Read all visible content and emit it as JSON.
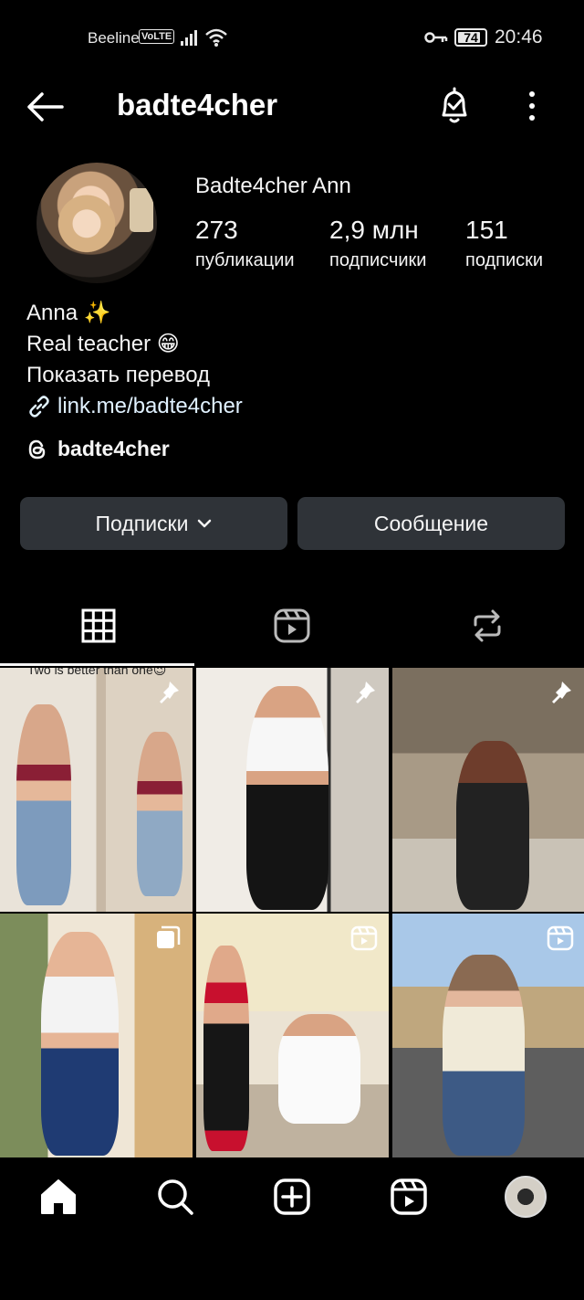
{
  "status_bar": {
    "carrier": "Beeline",
    "volte": "VoLTE",
    "battery": "74",
    "battery_level": 0.74,
    "time": "20:46"
  },
  "header": {
    "username": "badte4cher",
    "icons": [
      "back-arrow-icon",
      "notification-bell-icon",
      "more-icon"
    ]
  },
  "profile": {
    "full_name": "Badte4cher Ann",
    "stats": [
      {
        "value": "273",
        "label": "публикации"
      },
      {
        "value": "2,9 млн",
        "label": "подписчики"
      },
      {
        "value": "151",
        "label": "подписки"
      }
    ],
    "bio": {
      "line1": "Anna ✨",
      "line2": "Real teacher 😁",
      "translate": "Показать перевод",
      "link": "link.me/badte4cher"
    },
    "threads_handle": "badte4cher"
  },
  "actions": {
    "following_label": "Подписки",
    "message_label": "Сообщение"
  },
  "tabs": [
    "grid-icon",
    "reels-icon",
    "reposts-icon"
  ],
  "posts": [
    {
      "badge": "pin-icon",
      "caption": "Two is better than one😉"
    },
    {
      "badge": "pin-icon"
    },
    {
      "badge": "pin-icon"
    },
    {
      "badge": "carousel-icon"
    },
    {
      "badge": "reel-icon"
    },
    {
      "badge": "reel-icon"
    }
  ],
  "bottom_nav": [
    "home-icon",
    "search-icon",
    "create-icon",
    "reels-icon",
    "profile-avatar"
  ],
  "colors": {
    "background": "#000000",
    "button_bg": "#2f3338",
    "text": "#f5f5f5",
    "link": "#e0f1ff"
  }
}
